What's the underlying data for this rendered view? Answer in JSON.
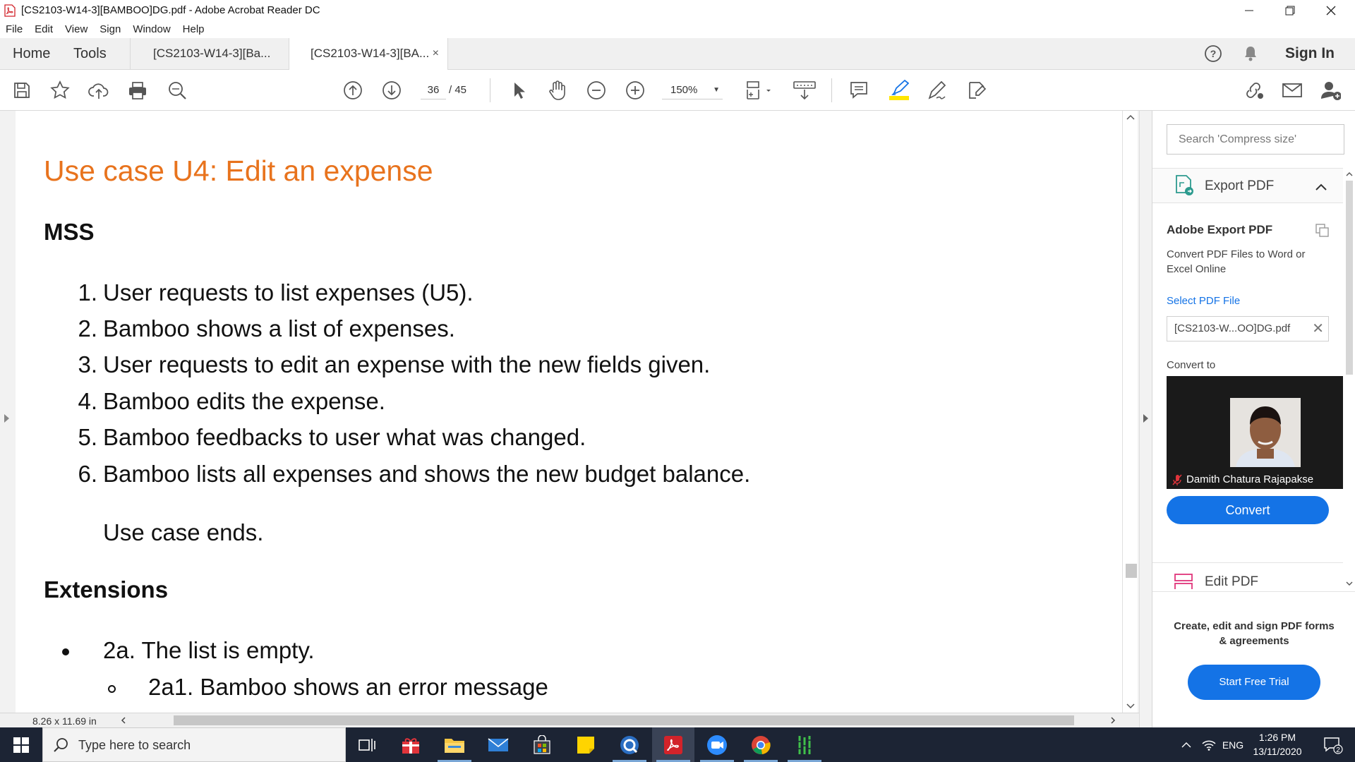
{
  "window": {
    "title": "[CS2103-W14-3][BAMBOO]DG.pdf - Adobe Acrobat Reader DC"
  },
  "menu": [
    "File",
    "Edit",
    "View",
    "Sign",
    "Window",
    "Help"
  ],
  "tabs": {
    "home": "Home",
    "tools": "Tools",
    "doc1": "[CS2103-W14-3][Ba...",
    "doc2": "[CS2103-W14-3][BA...",
    "close": "×",
    "signin": "Sign In"
  },
  "toolbar": {
    "page_current": "36",
    "page_total": "/  45",
    "zoom": "150%"
  },
  "document": {
    "title": "Use case U4: Edit an expense",
    "mss_heading": "MSS",
    "steps": [
      {
        "num": "1.",
        "text": "User requests to list expenses (U5)."
      },
      {
        "num": "2.",
        "text": "Bamboo shows a list of expenses."
      },
      {
        "num": "3.",
        "text": "User requests to edit an expense with the new fields given."
      },
      {
        "num": "4.",
        "text": "Bamboo edits the expense."
      },
      {
        "num": "5.",
        "text": "Bamboo feedbacks to user what was changed."
      },
      {
        "num": "6.",
        "text": "Bamboo lists all expenses and shows the new budget balance."
      }
    ],
    "ends": "Use case ends.",
    "extensions_heading": "Extensions",
    "ext_2a": "2a. The list is empty.",
    "ext_2a1": "2a1. Bamboo shows an error message",
    "page_size": "8.26 x 11.69 in"
  },
  "right_panel": {
    "search_placeholder": "Search 'Compress size'",
    "export_pdf": "Export PDF",
    "adobe_export_title": "Adobe Export PDF",
    "adobe_export_desc": "Convert PDF Files to Word or Excel Online",
    "select_pdf_file": "Select PDF File",
    "file_name": "[CS2103-W...OO]DG.pdf",
    "convert_to": "Convert to",
    "video_name": "Damith Chatura Rajapakse",
    "convert_button": "Convert",
    "edit_pdf": "Edit PDF",
    "promo": "Create, edit and sign PDF forms & agreements",
    "start_trial": "Start Free Trial"
  },
  "taskbar": {
    "search_placeholder": "Type here to search",
    "lang": "ENG",
    "time": "1:26 PM",
    "date": "13/11/2020",
    "notifications": "2"
  },
  "colors": {
    "heading_orange": "#e8731d",
    "accent_blue": "#1473e6",
    "taskbar": "#1c2434"
  }
}
